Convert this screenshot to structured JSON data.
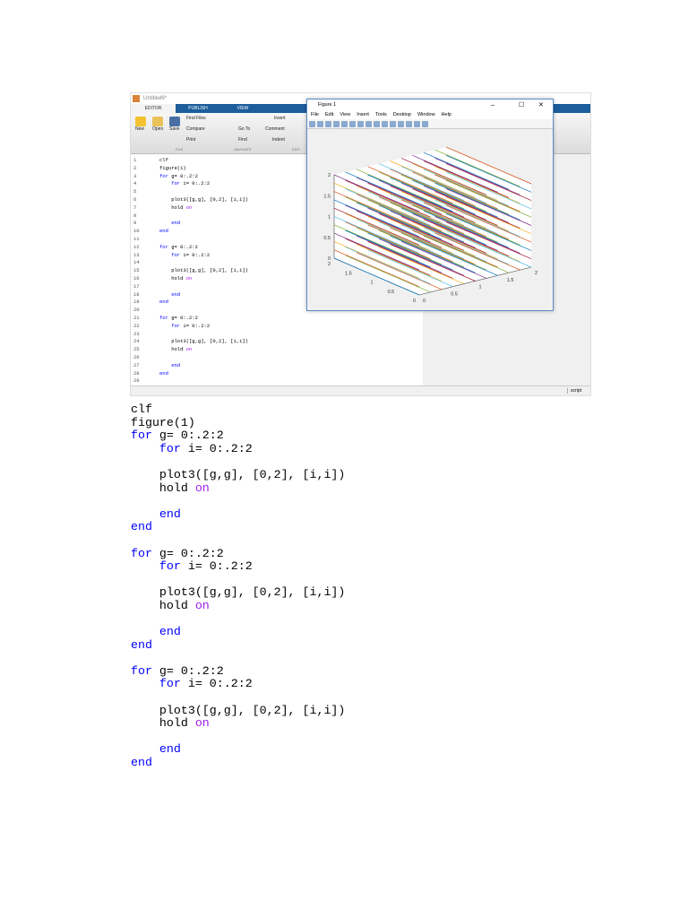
{
  "editor": {
    "title": "Untitled6*",
    "tabs": [
      "EDITOR",
      "PUBLISH",
      "VIEW"
    ],
    "buttons": {
      "new": "New",
      "open": "Open",
      "save": "Save",
      "find_files": "Find Files",
      "compare": "Compare",
      "print": "Print",
      "go_to": "Go To",
      "find": "Find",
      "insert": "Insert",
      "comment": "Comment",
      "indent": "Indent"
    },
    "sections": [
      "FILE",
      "NAVIGATE",
      "EDIT"
    ],
    "status": "script"
  },
  "figure": {
    "title": "Figure 1",
    "menu": [
      "File",
      "Edit",
      "View",
      "Insert",
      "Tools",
      "Desktop",
      "Window",
      "Help"
    ]
  },
  "code": [
    [
      [
        "clf",
        "t"
      ]
    ],
    [
      [
        "figure(1)",
        "t"
      ]
    ],
    [
      [
        "for",
        "k"
      ],
      [
        " g= 0:.2:2",
        "t"
      ]
    ],
    [
      [
        "    ",
        "t"
      ],
      [
        "for",
        "k"
      ],
      [
        " i= 0:.2:2",
        "t"
      ]
    ],
    [],
    [
      [
        "    plot3([g,g], [0,2], [i,i])",
        "t"
      ]
    ],
    [
      [
        "    hold ",
        "t"
      ],
      [
        "on",
        "s"
      ]
    ],
    [],
    [
      [
        "    ",
        "t"
      ],
      [
        "end",
        "k"
      ]
    ],
    [
      [
        "end",
        "k"
      ]
    ],
    [],
    [
      [
        "for",
        "k"
      ],
      [
        " g= 0:.2:2",
        "t"
      ]
    ],
    [
      [
        "    ",
        "t"
      ],
      [
        "for",
        "k"
      ],
      [
        " i= 0:.2:2",
        "t"
      ]
    ],
    [],
    [
      [
        "    plot3([g,g], [0,2], [i,i])",
        "t"
      ]
    ],
    [
      [
        "    hold ",
        "t"
      ],
      [
        "on",
        "s"
      ]
    ],
    [],
    [
      [
        "    ",
        "t"
      ],
      [
        "end",
        "k"
      ]
    ],
    [
      [
        "end",
        "k"
      ]
    ],
    [],
    [
      [
        "for",
        "k"
      ],
      [
        " g= 0:.2:2",
        "t"
      ]
    ],
    [
      [
        "    ",
        "t"
      ],
      [
        "for",
        "k"
      ],
      [
        " i= 0:.2:2",
        "t"
      ]
    ],
    [],
    [
      [
        "    plot3([g,g], [0,2], [i,i])",
        "t"
      ]
    ],
    [
      [
        "    hold ",
        "t"
      ],
      [
        "on",
        "s"
      ]
    ],
    [],
    [
      [
        "    ",
        "t"
      ],
      [
        "end",
        "k"
      ]
    ],
    [
      [
        "end",
        "k"
      ]
    ],
    []
  ],
  "chart_data": {
    "type": "line",
    "title": "",
    "g_values": [
      0,
      0.2,
      0.4,
      0.6,
      0.8,
      1,
      1.2,
      1.4,
      1.6,
      1.8,
      2
    ],
    "i_values": [
      0,
      0.2,
      0.4,
      0.6,
      0.8,
      1,
      1.2,
      1.4,
      1.6,
      1.8,
      2
    ],
    "y_range": [
      0,
      2
    ],
    "xlim": [
      0,
      2
    ],
    "ylim": [
      0,
      2
    ],
    "zlim": [
      0,
      2
    ],
    "ticks": [
      "0",
      "0.5",
      "1",
      "1.5",
      "2"
    ],
    "colors": [
      "#0072bd",
      "#d95319",
      "#edb120",
      "#7e2f8e",
      "#77ac30",
      "#4dbeee",
      "#a2142f"
    ]
  }
}
